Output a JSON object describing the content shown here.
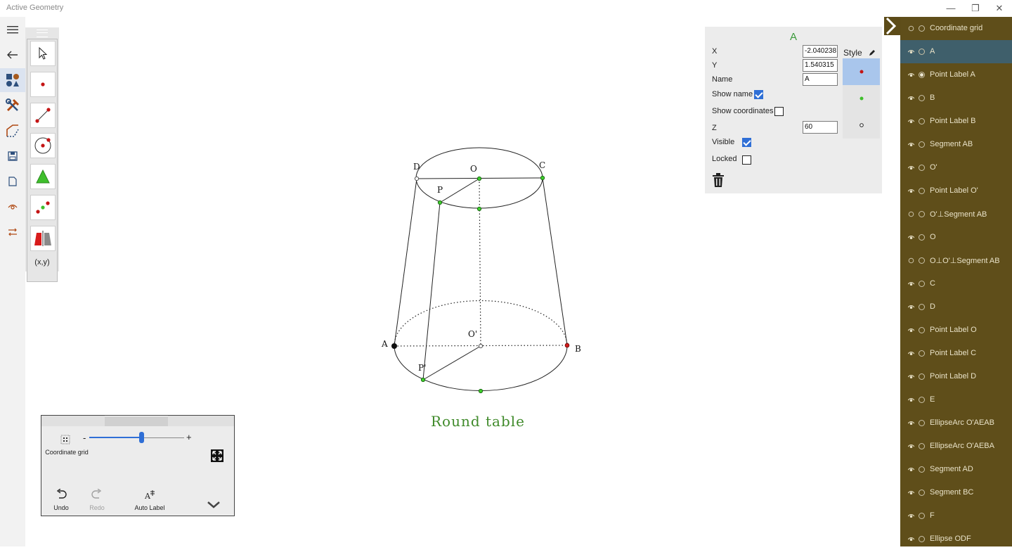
{
  "app": {
    "title": "Active Geometry"
  },
  "window": {
    "minimize": "—",
    "restore": "❐",
    "close": "✕"
  },
  "toolbox": {
    "coord_label": "(x,y)"
  },
  "figure": {
    "title": "Round table",
    "labels": {
      "A": "A",
      "B": "B",
      "C": "C",
      "D": "D",
      "O": "O",
      "O_prime": "O'",
      "P": "P",
      "P_prime": "P'"
    }
  },
  "properties": {
    "title": "A",
    "x_label": "X",
    "x_value": "-2.040238",
    "y_label": "Y",
    "y_value": "1.540315",
    "name_label": "Name",
    "name_value": "A",
    "show_name_label": "Show name",
    "show_name": true,
    "show_coords_label": "Show coordinates",
    "show_coords": false,
    "z_label": "Z",
    "z_value": "60",
    "visible_label": "Visible",
    "visible": true,
    "locked_label": "Locked",
    "locked": false,
    "style_label": "Style",
    "colors": {
      "title": "#3a9a3a",
      "selected_style": "#a9c6ec"
    }
  },
  "objects": [
    {
      "label": "Coordinate grid",
      "eye": false,
      "filled": false,
      "selected": false
    },
    {
      "label": "A",
      "eye": true,
      "filled": false,
      "selected": true
    },
    {
      "label": "Point Label A",
      "eye": true,
      "filled": true,
      "selected": false
    },
    {
      "label": "B",
      "eye": true,
      "filled": false,
      "selected": false
    },
    {
      "label": "Point Label B",
      "eye": true,
      "filled": false,
      "selected": false
    },
    {
      "label": "Segment AB",
      "eye": true,
      "filled": false,
      "selected": false
    },
    {
      "label": "O'",
      "eye": true,
      "filled": false,
      "selected": false
    },
    {
      "label": "Point Label O'",
      "eye": true,
      "filled": false,
      "selected": false
    },
    {
      "label": "O'⊥Segment AB",
      "eye": false,
      "filled": false,
      "selected": false
    },
    {
      "label": "O",
      "eye": true,
      "filled": false,
      "selected": false
    },
    {
      "label": "O⊥O'⊥Segment AB",
      "eye": false,
      "filled": false,
      "selected": false
    },
    {
      "label": "C",
      "eye": true,
      "filled": false,
      "selected": false
    },
    {
      "label": "D",
      "eye": true,
      "filled": false,
      "selected": false
    },
    {
      "label": "Point Label O",
      "eye": true,
      "filled": false,
      "selected": false
    },
    {
      "label": "Point Label C",
      "eye": true,
      "filled": false,
      "selected": false
    },
    {
      "label": "Point Label D",
      "eye": true,
      "filled": false,
      "selected": false
    },
    {
      "label": "E",
      "eye": true,
      "filled": false,
      "selected": false
    },
    {
      "label": "EllipseArc O'AEAB",
      "eye": true,
      "filled": false,
      "selected": false
    },
    {
      "label": "EllipseArc O'AEBA",
      "eye": true,
      "filled": false,
      "selected": false
    },
    {
      "label": "Segment AD",
      "eye": true,
      "filled": false,
      "selected": false
    },
    {
      "label": "Segment BC",
      "eye": true,
      "filled": false,
      "selected": false
    },
    {
      "label": "F",
      "eye": true,
      "filled": false,
      "selected": false
    },
    {
      "label": "Ellipse ODF",
      "eye": true,
      "filled": false,
      "selected": false
    }
  ],
  "zoom": {
    "grid_label": "Coordinate grid",
    "minus": "-",
    "plus": "+",
    "slider_level": 0.55,
    "undo_label": "Undo",
    "redo_label": "Redo",
    "auto_label": "Auto Label"
  }
}
